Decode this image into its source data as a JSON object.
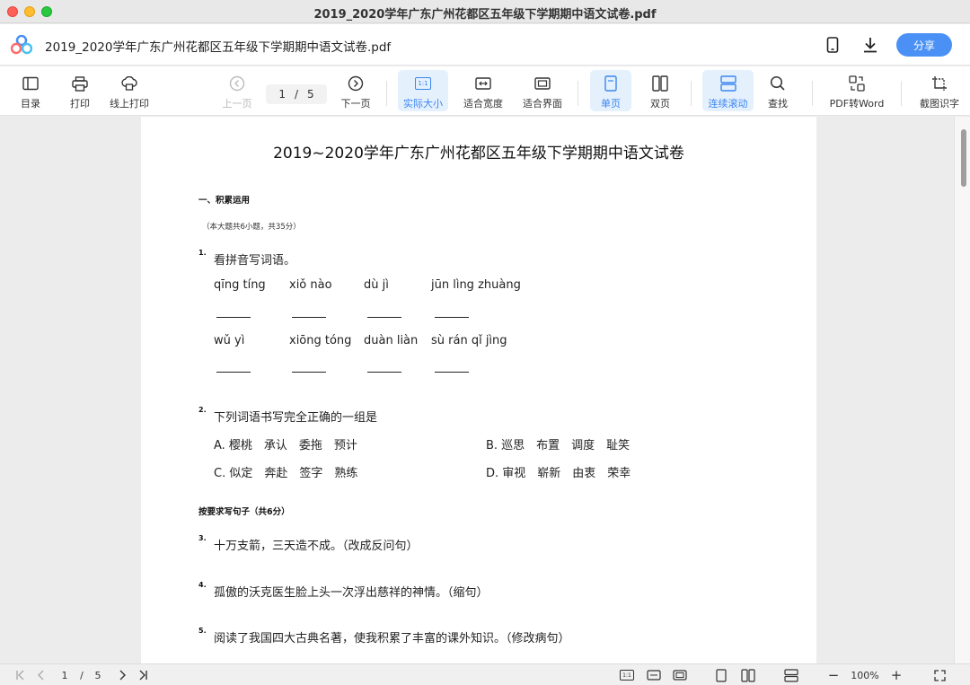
{
  "window": {
    "title": "2019_2020学年广东广州花都区五年级下学期期中语文试卷.pdf"
  },
  "header": {
    "file_name": "2019_2020学年广东广州花都区五年级下学期期中语文试卷.pdf",
    "share_label": "分享"
  },
  "toolbar": {
    "toc": "目录",
    "print": "打印",
    "online_print": "线上打印",
    "prev_page": "上一页",
    "page_current": "1",
    "page_sep": "/",
    "page_total": "5",
    "next_page": "下一页",
    "actual_size": "实际大小",
    "fit_width": "适合宽度",
    "fit_page": "适合界面",
    "single_page": "单页",
    "double_page": "双页",
    "continuous": "连续滚动",
    "search": "查找",
    "pdf_to_word": "PDF转Word",
    "ocr": "截图识字",
    "actual_size_icon_text": "1:1"
  },
  "document": {
    "title": "2019~2020学年广东广州花都区五年级下学期期中语文试卷",
    "section1": {
      "heading": "一、积累运用",
      "note": "（本大题共6小题，共35分）"
    },
    "q1": {
      "num": "1.",
      "text": "看拼音写词语。",
      "row1": [
        "qīng tíng",
        "xiǒ nào",
        "dù jì",
        "jūn lìng zhuàng"
      ],
      "row2": [
        "wǔ yì",
        "xiōng tóng",
        "duàn liàn",
        "sù rán qǐ jìng"
      ]
    },
    "q2": {
      "num": "2.",
      "text": "下列词语书写完全正确的一组是",
      "options": [
        "A. 樱桃　承认　委拖　预计",
        "B. 巡思　布置　调度　耻笑",
        "C. 似定　奔赴　签字　熟练",
        "D. 审视　崭新　由衷　荣幸"
      ]
    },
    "section2": {
      "heading": "按要求写句子（共6分）"
    },
    "q3": {
      "num": "3.",
      "text": "十万支箭，三天造不成。（改成反问句）"
    },
    "q4": {
      "num": "4.",
      "text": "孤傲的沃克医生脸上头一次浮出慈祥的神情。（缩句）"
    },
    "q5": {
      "num": "5.",
      "text": "阅读了我国四大古典名著，使我积累了丰富的课外知识。（修改病句）"
    }
  },
  "statusbar": {
    "page_current": "1",
    "page_sep": "/",
    "page_total": "5",
    "zoom": "100%",
    "zoom_out": "−",
    "zoom_in": "+",
    "actual_icon_text": "1:1"
  }
}
